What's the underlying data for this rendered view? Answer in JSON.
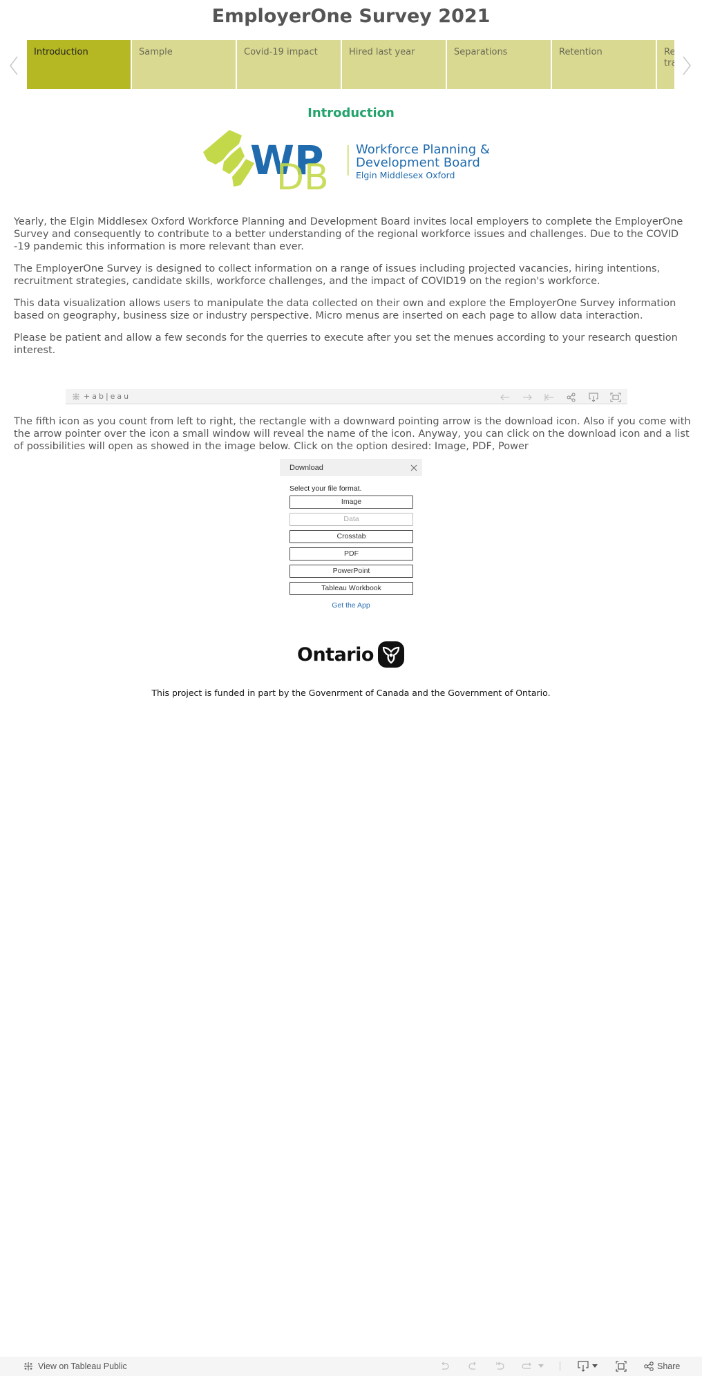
{
  "header": {
    "title": "EmployerOne Survey 2021"
  },
  "tabs": [
    {
      "label": "Introduction",
      "active": true
    },
    {
      "label": "Sample",
      "active": false
    },
    {
      "label": "Covid-19 impact",
      "active": false
    },
    {
      "label": "Hired last year",
      "active": false
    },
    {
      "label": "Separations",
      "active": false
    },
    {
      "label": "Retention",
      "active": false
    },
    {
      "label": "Re tra",
      "active": false
    }
  ],
  "nav": {
    "prev_icon": "chevron-left-icon",
    "next_icon": "chevron-right-icon"
  },
  "section": {
    "heading": "Introduction"
  },
  "logo": {
    "letters_top": "WP",
    "letters_bottom": "DB",
    "line1": "Workforce Planning &",
    "line2": "Development Board",
    "line3": "Elgin Middlesex Oxford",
    "colors": {
      "blue": "#1f6bad",
      "lime": "#c4d94a",
      "green": "#3dbb5a"
    }
  },
  "intro_paragraphs": [
    "Yearly, the Elgin Middlesex Oxford Workforce Planning and Development Board invites local employers to complete the EmployerOne Survey and consequently to contribute to a better understanding of the regional workforce issues and challenges. Due to the COVID -19 pandemic this information is more relevant than ever.",
    "The EmployerOne Survey is designed to collect information on a range of issues including projected vacancies, hiring intentions, recruitment strategies, candidate skills, workforce challenges, and the impact of COVID19 on the region's workforce.",
    "This data visualization allows users to manipulate the data collected on their own and explore the EmployerOne Survey information based on geography, business size or industry perspective. Micro menus are inserted on each page to allow data interaction.",
    "Please be patient and allow a few seconds for the querries to execute after you set the menues according to your research question interest."
  ],
  "toolbar_image": {
    "brand": "+ab|eau",
    "icons": [
      "undo-arrow-icon",
      "redo-arrow-icon",
      "revert-icon",
      "share-icon",
      "download-icon",
      "fullscreen-icon"
    ]
  },
  "download_explanation": "The fifth icon as you count from left to right, the rectangle with a downward pointing arrow is the download icon. Also if you come with the arrow pointer over the icon a small window will reveal the name of the icon. Anyway, you can click on the download icon and a list of possibilities will open as showed in the image below. Click on the option desired: Image, PDF, Power",
  "download_dialog": {
    "title": "Download",
    "prompt": "Select your file format.",
    "options": [
      {
        "label": "Image",
        "enabled": true
      },
      {
        "label": "Data",
        "enabled": false
      },
      {
        "label": "Crosstab",
        "enabled": true
      },
      {
        "label": "PDF",
        "enabled": true
      },
      {
        "label": "PowerPoint",
        "enabled": true
      },
      {
        "label": "Tableau Workbook",
        "enabled": true
      }
    ],
    "link": "Get the App"
  },
  "ontario": {
    "wordmark": "Ontario"
  },
  "funding_text": "This project is funded in part by the Govenrment of Canada and the Government of Ontario.",
  "bottom_bar": {
    "view_link": "View on Tableau Public",
    "share_label": "Share"
  }
}
